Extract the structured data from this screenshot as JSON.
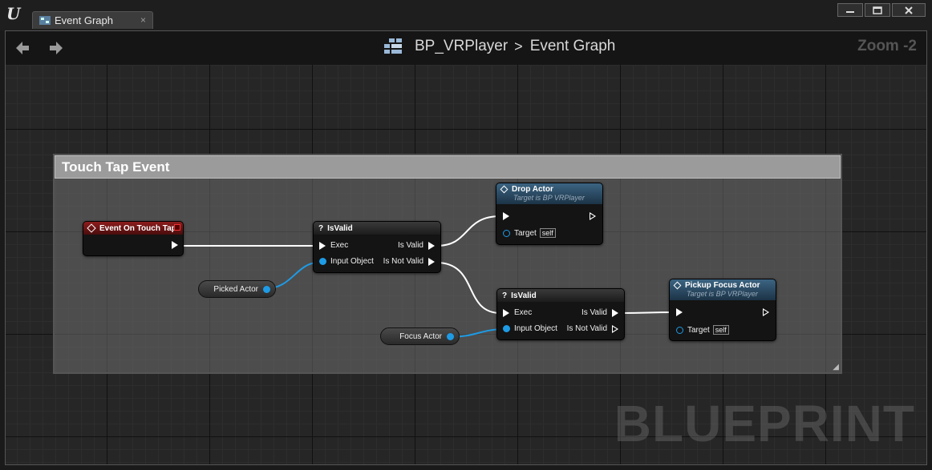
{
  "window": {
    "tab_label": "Event Graph",
    "tab_close": "×",
    "controls": {
      "minimize": "▁",
      "maximize": "□",
      "close": "✕"
    }
  },
  "navbar": {
    "breadcrumb_blueprint": "BP_VRPlayer",
    "breadcrumb_separator": ">",
    "breadcrumb_graph": "Event Graph",
    "zoom": "Zoom -2"
  },
  "watermark": "BLUEPRINT",
  "comment": {
    "title": "Touch Tap Event"
  },
  "nodes": {
    "event_touch_tap": {
      "title": "Event On Touch Tap"
    },
    "isvalid_1": {
      "title": "IsValid",
      "exec_label": "Exec",
      "input_label": "Input Object",
      "is_valid_label": "Is Valid",
      "is_not_valid_label": "Is Not Valid"
    },
    "drop_actor": {
      "title": "Drop Actor",
      "subtitle": "Target is BP VRPlayer",
      "target_label": "Target",
      "target_value": "self"
    },
    "isvalid_2": {
      "title": "IsValid",
      "exec_label": "Exec",
      "input_label": "Input Object",
      "is_valid_label": "Is Valid",
      "is_not_valid_label": "Is Not Valid"
    },
    "pickup_focus_actor": {
      "title": "Pickup Focus Actor",
      "subtitle": "Target is BP VRPlayer",
      "target_label": "Target",
      "target_value": "self"
    }
  },
  "variables": {
    "picked_actor": "Picked Actor",
    "focus_actor": "Focus Actor"
  },
  "colors": {
    "exec_wire": "#ffffff",
    "object_wire": "#1e9be6",
    "event_header": "#8e1d1d",
    "function_header": "#3b6482"
  }
}
